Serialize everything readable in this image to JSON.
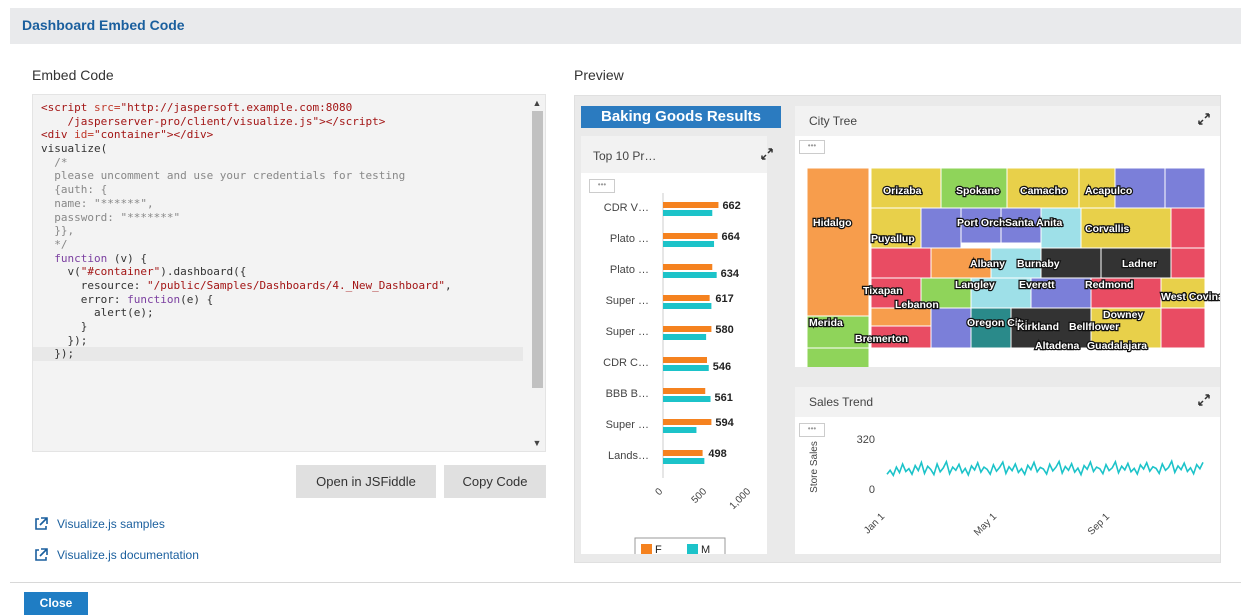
{
  "header": {
    "title": "Dashboard Embed Code"
  },
  "embed": {
    "label": "Embed Code",
    "code_lines": [
      [
        {
          "t": "tag",
          "s": "<script "
        },
        {
          "t": "attr",
          "s": "src="
        },
        {
          "t": "str",
          "s": "\"http://jaspersoft.example.com:8080"
        }
      ],
      [
        {
          "t": "str",
          "s": "    /jasperserver-pro/client/visualize.js\""
        },
        {
          "t": "tag",
          "s": "></"
        },
        {
          "t": "tag",
          "s": "script>"
        }
      ],
      [
        {
          "t": "tag",
          "s": "<div "
        },
        {
          "t": "attr",
          "s": "id="
        },
        {
          "t": "str",
          "s": "\"container\""
        },
        {
          "t": "tag",
          "s": "></div>"
        }
      ],
      [
        {
          "t": "plain",
          "s": "visualize("
        }
      ],
      [
        {
          "t": "com",
          "s": "  /*"
        }
      ],
      [
        {
          "t": "com",
          "s": "  please uncomment and use your credentials for testing"
        }
      ],
      [
        {
          "t": "com",
          "s": "  {auth: {"
        }
      ],
      [
        {
          "t": "com",
          "s": "  name: \"******\","
        }
      ],
      [
        {
          "t": "com",
          "s": "  password: \"*******\""
        }
      ],
      [
        {
          "t": "com",
          "s": "  }},"
        }
      ],
      [
        {
          "t": "com",
          "s": "  */"
        }
      ],
      [
        {
          "t": "kw",
          "s": "  function"
        },
        {
          "t": "plain",
          "s": " (v) {"
        }
      ],
      [
        {
          "t": "plain",
          "s": "    v("
        },
        {
          "t": "str",
          "s": "\"#container\""
        },
        {
          "t": "plain",
          "s": ").dashboard({"
        }
      ],
      [
        {
          "t": "plain",
          "s": "      resource: "
        },
        {
          "t": "str",
          "s": "\"/public/Samples/Dashboards/4._New_Dashboard\""
        },
        {
          "t": "plain",
          "s": ","
        }
      ],
      [
        {
          "t": "plain",
          "s": "      error: "
        },
        {
          "t": "kw",
          "s": "function"
        },
        {
          "t": "plain",
          "s": "(e) {"
        }
      ],
      [
        {
          "t": "plain",
          "s": "        alert(e);"
        }
      ],
      [
        {
          "t": "plain",
          "s": "      }"
        }
      ],
      [
        {
          "t": "plain",
          "s": "    });"
        }
      ],
      [
        {
          "t": "plain",
          "s": "  });"
        }
      ]
    ],
    "active_line": 18
  },
  "buttons": {
    "jsfiddle": "Open in JSFiddle",
    "copy": "Copy Code",
    "close": "Close"
  },
  "links": {
    "samples": "Visualize.js samples",
    "docs": "Visualize.js documentation"
  },
  "preview": {
    "label": "Preview",
    "brand": "Baking Goods Results",
    "top10": {
      "title": "Top 10 Pr…",
      "menu": "•••",
      "legend": [
        "F",
        "M"
      ]
    },
    "city_tree": {
      "title": "City Tree",
      "menu": "•••",
      "labels": [
        "Orizaba",
        "Spokane",
        "Camacho",
        "Acapulco",
        "Hidalgo",
        "Port Orchard",
        "Santa Anita",
        "Puyallup",
        "Corvallis",
        "Albany",
        "Burnaby",
        "Ladner",
        "Tixapan",
        "Langley",
        "Everett",
        "Redmond",
        "West Covina",
        "Lebanon",
        "Downey",
        "Merida",
        "Oregon City",
        "Kirkland",
        "Bellflower",
        "Bremerton",
        "Altadena",
        "Guadalajara"
      ]
    },
    "sales_trend": {
      "title": "Sales Trend",
      "menu": "•••",
      "ylabel": "Store Sales"
    }
  },
  "chart_data": [
    {
      "type": "bar",
      "title": "Top 10 Pr…",
      "categories": [
        "CDR V…",
        "Plato …",
        "Plato …",
        "Super …",
        "Super …",
        "CDR C…",
        "BBB B…",
        "Super …",
        "Lands…"
      ],
      "series": [
        {
          "name": "F",
          "color": "#f5821f",
          "values": [
            630,
            620,
            560,
            530,
            550,
            500,
            480,
            550,
            450
          ]
        },
        {
          "name": "M",
          "color": "#1cc3c9",
          "values": [
            560,
            580,
            610,
            550,
            490,
            520,
            540,
            380,
            470
          ]
        }
      ],
      "data_labels": [
        "662",
        "664",
        "634",
        "617",
        "580",
        "546",
        "561",
        "594",
        "498"
      ],
      "xticks": [
        "0",
        "500",
        "1,000"
      ],
      "xlim": [
        0,
        1000
      ]
    },
    {
      "type": "line",
      "title": "Sales Trend",
      "ylabel": "Store Sales",
      "yticks": [
        "320",
        "0"
      ],
      "ylim": [
        0,
        320
      ],
      "xticks": [
        "Jan 1",
        "May 1",
        "Sep 1"
      ],
      "series": [
        {
          "color": "#1cc3c9",
          "values": [
            95,
            120,
            88,
            140,
            105,
            160,
            112,
            130,
            95,
            150,
            118,
            170,
            100,
            145,
            125,
            92,
            160,
            110,
            135,
            175,
            98,
            140,
            120,
            158,
            104,
            132,
            90,
            148,
            122,
            168,
            108,
            140,
            126,
            95,
            155,
            114,
            138,
            172,
            100,
            142,
            118,
            160,
            106,
            130,
            94,
            152,
            124,
            170,
            110,
            138,
            128,
            96,
            158,
            116,
            140,
            176,
            102,
            144,
            120,
            162,
            108,
            134,
            92,
            150,
            126,
            172,
            112,
            140,
            130,
            98,
            156,
            118,
            136,
            174,
            104,
            146,
            122,
            164,
            110,
            132,
            96,
            154,
            128,
            168,
            114,
            142,
            132,
            100,
            160,
            120,
            138,
            178,
            106,
            148,
            124,
            166,
            112,
            136,
            98,
            156,
            130,
            170
          ]
        }
      ]
    }
  ]
}
